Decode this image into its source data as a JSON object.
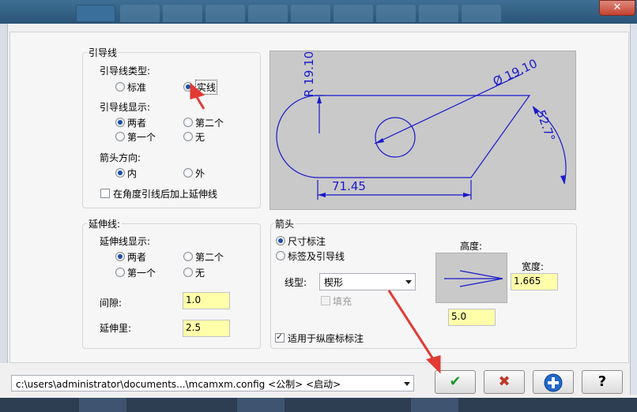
{
  "leader_group": {
    "title": "引导线",
    "type_label": "引导线类型:",
    "type_options": [
      "标准",
      "实线"
    ],
    "display_label": "引导线显示:",
    "display_options": [
      "两者",
      "第二个",
      "第一个",
      "无"
    ],
    "arrow_dir_label": "箭头方向:",
    "arrow_dir_options": [
      "内",
      "外"
    ],
    "extend_after_angle": "在角度引线后加上延伸线"
  },
  "extension_group": {
    "title": "延伸线:",
    "display_label": "延伸线显示:",
    "display_options": [
      "两者",
      "第二个",
      "第一个",
      "无"
    ],
    "gap_label": "间隙:",
    "gap_value": "1.0",
    "extension_label": "延伸里:",
    "extension_value": "2.5"
  },
  "arrow_group": {
    "title": "箭头",
    "options": [
      "尺寸标注",
      "标签及引导线"
    ],
    "line_type_label": "线型:",
    "line_type_value": "楔形",
    "fill_label": "填充",
    "height_label": "高度:",
    "width_label": "宽度:",
    "width_value": "1.665",
    "height_value": "5.0",
    "ordinate_label": "适用于纵座标标注"
  },
  "preview_labels": {
    "radius": "R 19.10",
    "diameter": "Ø 19.10",
    "angle": "52.7°",
    "length": "71.45"
  },
  "config_path": "c:\\users\\administrator\\documents...\\mcamxm.config <公制> <启动>",
  "window": {
    "close_glyph": "✕"
  },
  "buttons": {
    "ok": "✔",
    "cancel": "✖",
    "help": "?"
  },
  "colors": {
    "accent_field": "#ffffaa",
    "dimension_line": "#1a1acc",
    "annotation_arrow": "#e23a35",
    "ok_green": "#1d9a2b",
    "cancel_red": "#c0392b",
    "apply_blue": "#2169c9"
  }
}
